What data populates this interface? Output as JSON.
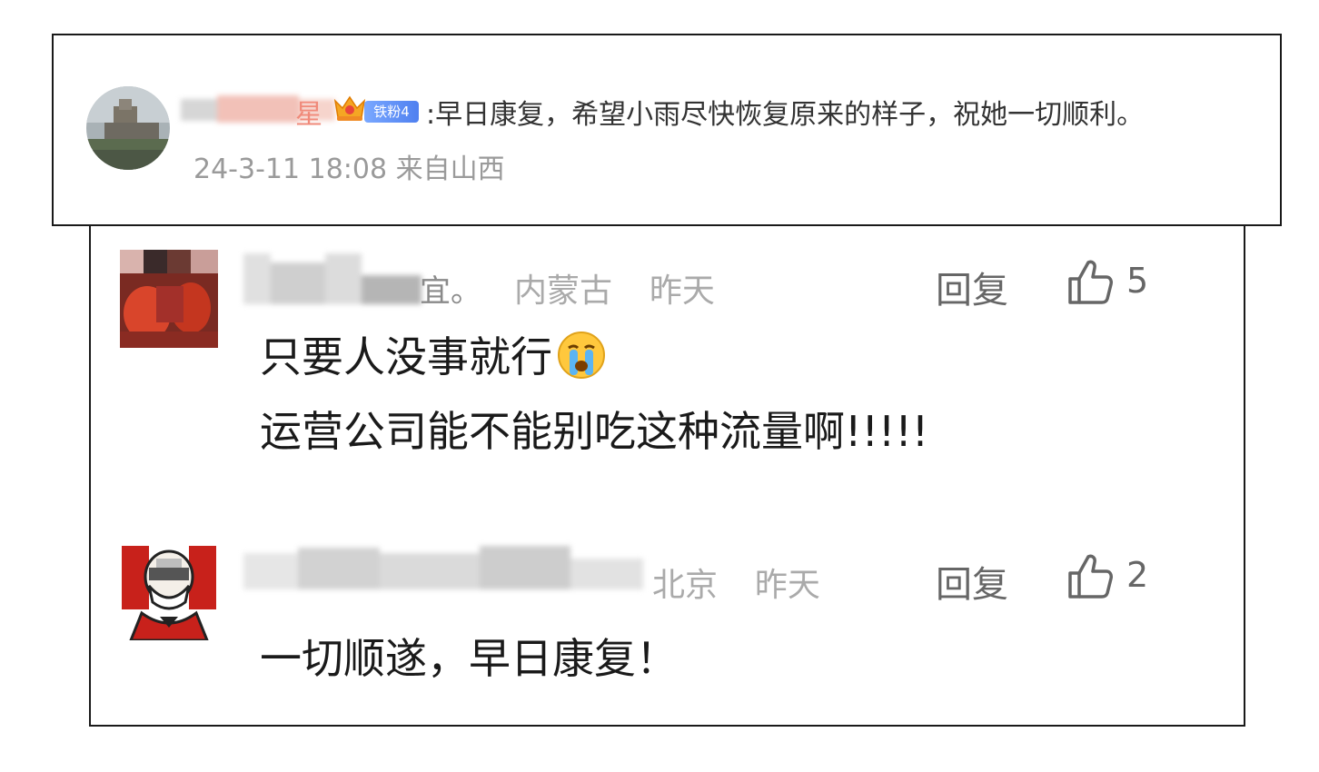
{
  "top_comment": {
    "name_visible_fragment": "星",
    "fan_badge": "铁粉4",
    "text": ":早日康复，希望小雨尽快恢复原来的样子，祝她一切顺利。",
    "timestamp": "24-3-11 18:08",
    "source": "来自山西"
  },
  "replies": [
    {
      "name_visible_fragment": "宜。",
      "location": "内蒙古",
      "time": "昨天",
      "reply_label": "回复",
      "likes": "5",
      "lines": [
        "只要人没事就行",
        "运营公司能不能别吃这种流量啊!!!!!"
      ],
      "emoji": "crying-face"
    },
    {
      "name_visible_fragment": "",
      "location": "北京",
      "time": "昨天",
      "reply_label": "回复",
      "likes": "2",
      "lines": [
        "一切顺遂，早日康复！"
      ]
    }
  ],
  "colors": {
    "meta_gray": "#9a9a9a",
    "action_gray": "#666666",
    "text_dark": "#1a1a1a",
    "badge_blue": "#4f80f0"
  }
}
